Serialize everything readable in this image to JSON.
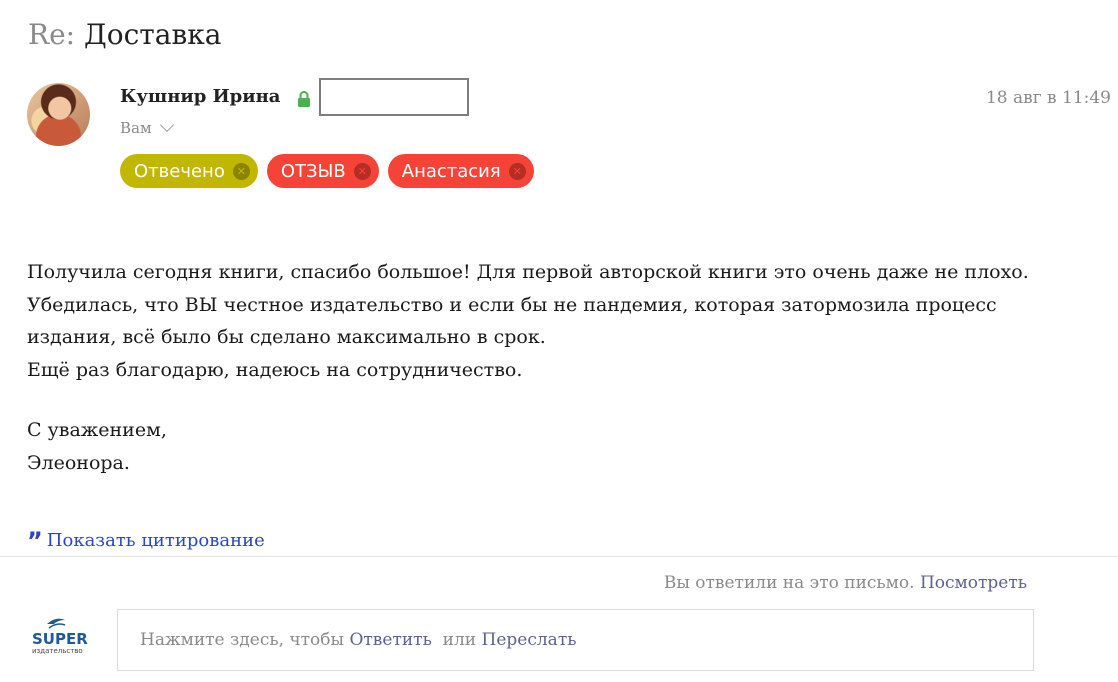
{
  "message": {
    "subject_prefix": "Re:",
    "subject": "Доставка",
    "sender_name": "Кушнир Ирина",
    "recipient": "Вам",
    "date": "18 авг в 11:49",
    "tags": [
      {
        "label": "Отвечено",
        "color": "#c1b600"
      },
      {
        "label": "ОТЗЫВ",
        "color": "#f54337"
      },
      {
        "label": "Анастасия",
        "color": "#f54337"
      }
    ],
    "body_lines": [
      "Получила сегодня книги, спасибо большое! Для первой авторской книги это очень даже не плохо.",
      "Убедилась, что ВЫ честное издательство и если бы не пандемия, которая затормозила процесс",
      "издания, всё было бы сделано максимально в срок.",
      "Ещё раз благодарю, надеюсь на сотрудничество."
    ],
    "signature_lines": [
      "С уважением,",
      "Элеонора."
    ],
    "show_quote_label": "Показать цитирование",
    "replied_text": "Вы ответили на это письмо.",
    "view_link": "Посмотреть"
  },
  "reply": {
    "prompt": "Нажмите здесь, чтобы",
    "reply_label": "Ответить",
    "or_label": "или",
    "forward_label": "Переслать"
  },
  "logo": {
    "main": "SUPER",
    "sub": "издательство"
  },
  "colors": {
    "accent_link": "#5d6190",
    "quote_link": "#2a46c4",
    "tag_green": "#c1b600",
    "tag_red": "#f54337",
    "lock_green": "#4caf50"
  },
  "icons": [
    "lock-icon",
    "chevron-down-icon",
    "close-icon",
    "quote-icon"
  ]
}
